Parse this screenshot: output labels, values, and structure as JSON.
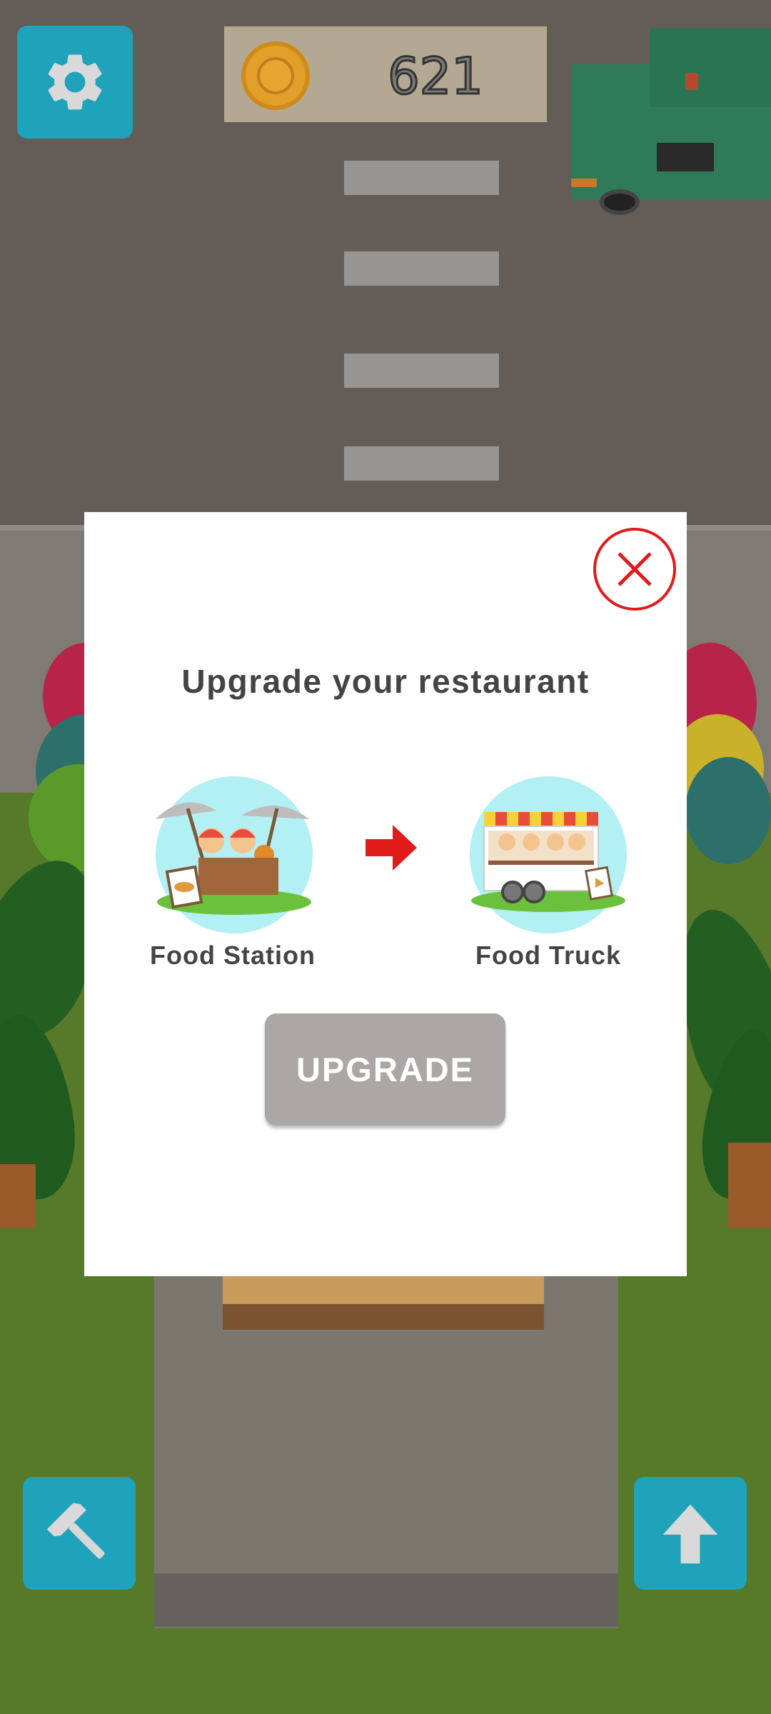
{
  "hud": {
    "coin_count": "621",
    "settings_icon": "gear-icon",
    "coin_icon": "coin-icon",
    "build_icon": "hammer-icon",
    "upgrade_icon": "up-arrow-icon"
  },
  "modal": {
    "title": "Upgrade your restaurant",
    "current": {
      "label": "Food Station",
      "icon": "food-station-icon"
    },
    "next": {
      "label": "Food Truck",
      "icon": "food-truck-icon"
    },
    "upgrade_label": "UPGRADE",
    "close_icon": "close-icon"
  },
  "colors": {
    "accent_button": "#1fa3bb",
    "close_red": "#e11a1a",
    "upgrade_button": "#aca6a5",
    "modal_text": "#444444"
  }
}
